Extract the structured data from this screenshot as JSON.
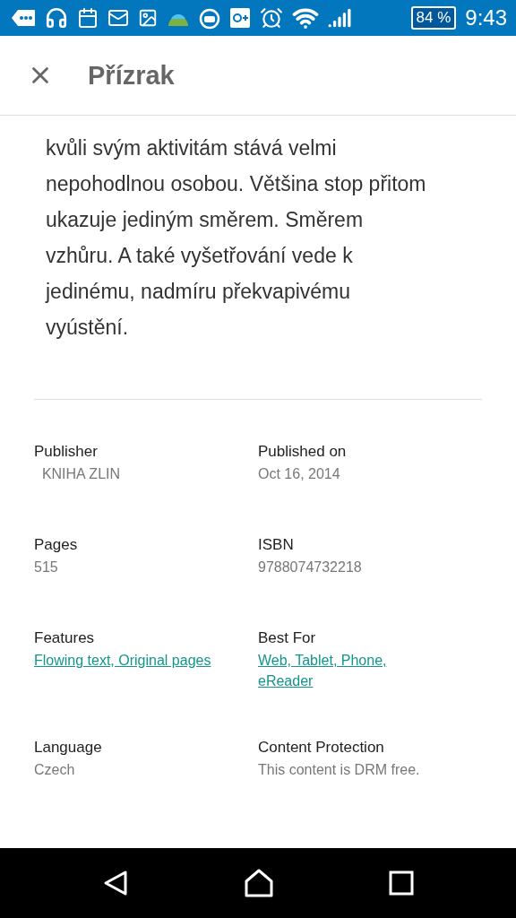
{
  "status_bar": {
    "battery": "84 %",
    "time": "9:43"
  },
  "header": {
    "title": "Přízrak"
  },
  "description": {
    "lines": [
      "kvůli svým aktivitám stává velmi",
      "nepohodlnou osobou. Většina stop přitom",
      "ukazuje jediným směrem. Směrem",
      "vzhůru. A také vyšetřování vede k",
      "jedinému, nadmíru překvapivému",
      "vyústění."
    ]
  },
  "details": [
    {
      "label": "Publisher",
      "value": "  KNIHA ZLIN",
      "kind": "text"
    },
    {
      "label": "Published on",
      "value": "Oct 16, 2014",
      "kind": "text"
    },
    {
      "label": "Pages",
      "value": "515",
      "kind": "text"
    },
    {
      "label": "ISBN",
      "value": "9788074732218",
      "kind": "text"
    },
    {
      "label": "Features",
      "value": "Flowing text, Original pages",
      "kind": "link"
    },
    {
      "label": "Best For",
      "value": "Web, Tablet, Phone, eReader",
      "kind": "link"
    },
    {
      "label": "Language",
      "value": "Czech",
      "kind": "text"
    },
    {
      "label": "Content Protection",
      "value": "This content is DRM free.",
      "kind": "text"
    }
  ]
}
